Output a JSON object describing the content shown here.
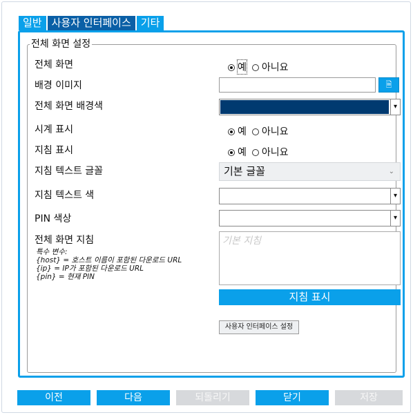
{
  "tabs": [
    {
      "label": "일반"
    },
    {
      "label": "사용자 인터페이스"
    },
    {
      "label": "기타"
    }
  ],
  "section": {
    "legend": "전체 화면 설정"
  },
  "fields": {
    "fullscreen": {
      "label": "전체 화면",
      "opt_yes": "예",
      "opt_no": "아니요",
      "selected": "예"
    },
    "bg_image": {
      "label": "배경 이미지",
      "value": ""
    },
    "bg_color": {
      "label": "전체 화면 배경색",
      "color": "#003a70"
    },
    "clock": {
      "label": "시계 표시",
      "opt_yes": "예",
      "opt_no": "아니요",
      "selected": "예"
    },
    "guide": {
      "label": "지침 표시",
      "opt_yes": "예",
      "opt_no": "아니요",
      "selected": "예"
    },
    "guide_font": {
      "label": "지침 텍스트 글꼴",
      "value": "기본 글꼴"
    },
    "guide_color": {
      "label": "지침 텍스트 색",
      "color": "#ffffff"
    },
    "pin_color": {
      "label": "PIN 색상",
      "color": "#ffffff"
    },
    "fs_guide": {
      "label": "전체 화면 지침",
      "placeholder": "기본 지침",
      "notes": [
        "특수 변수:",
        "{host} = 호스트 이름이 포함된 다운로드 URL",
        "{ip} = IP가 포함된 다운로드 URL",
        "{pin} = 현재 PIN"
      ]
    }
  },
  "buttons": {
    "show_guide": "지침 표시",
    "ui_settings": "사용자 인터페이스 설정",
    "prev": "이전",
    "next": "다음",
    "revert": "되돌리기",
    "close": "닫기",
    "save": "저장"
  },
  "colors": {
    "accent": "#0aa0ea",
    "active_tab": "#0a5fa6",
    "disabled": "#d7d9dc"
  }
}
